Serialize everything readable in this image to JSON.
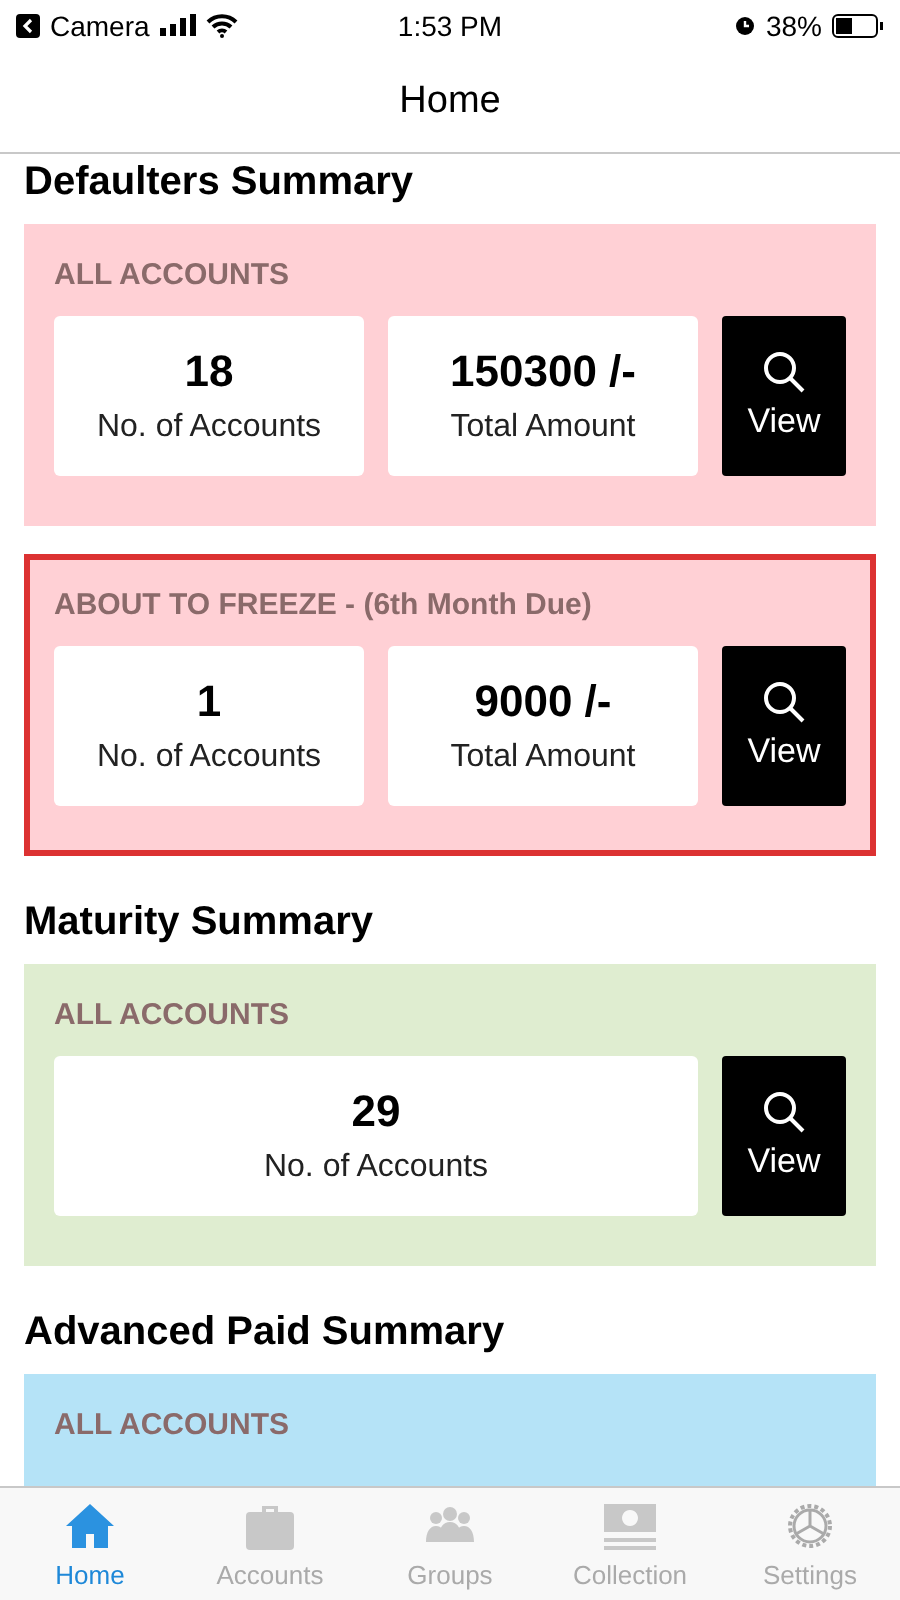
{
  "status_bar": {
    "back_app": "Camera",
    "time": "1:53 PM",
    "battery": "38%"
  },
  "nav": {
    "title": "Home"
  },
  "sections": [
    {
      "title": "Defaulters Summary",
      "panels": [
        {
          "label": "ALL ACCOUNTS",
          "color": "#ffd0d5",
          "alert": false,
          "stats": [
            {
              "value": "18",
              "caption": "No. of Accounts"
            },
            {
              "value": "150300 /-",
              "caption": "Total Amount"
            }
          ],
          "button": "View"
        },
        {
          "label": "ABOUT TO FREEZE - (6th Month Due)",
          "color": "#ffd0d5",
          "alert": true,
          "stats": [
            {
              "value": "1",
              "caption": "No. of Accounts"
            },
            {
              "value": "9000 /-",
              "caption": "Total Amount"
            }
          ],
          "button": "View"
        }
      ]
    },
    {
      "title": "Maturity Summary",
      "panels": [
        {
          "label": "ALL ACCOUNTS",
          "color": "#dfedd0",
          "alert": false,
          "stats": [
            {
              "value": "29",
              "caption": "No. of Accounts"
            }
          ],
          "button": "View"
        }
      ]
    },
    {
      "title": "Advanced Paid Summary",
      "panels": [
        {
          "label": "ALL ACCOUNTS",
          "color": "#b5e3f7",
          "alert": false
        }
      ]
    }
  ],
  "tabs": [
    {
      "label": "Home",
      "kind": "home",
      "selected": true
    },
    {
      "label": "Accounts",
      "kind": "briefcase",
      "selected": false
    },
    {
      "label": "Groups",
      "kind": "people",
      "selected": false
    },
    {
      "label": "Collection",
      "kind": "cash",
      "selected": false
    },
    {
      "label": "Settings",
      "kind": "gear",
      "selected": false
    }
  ]
}
